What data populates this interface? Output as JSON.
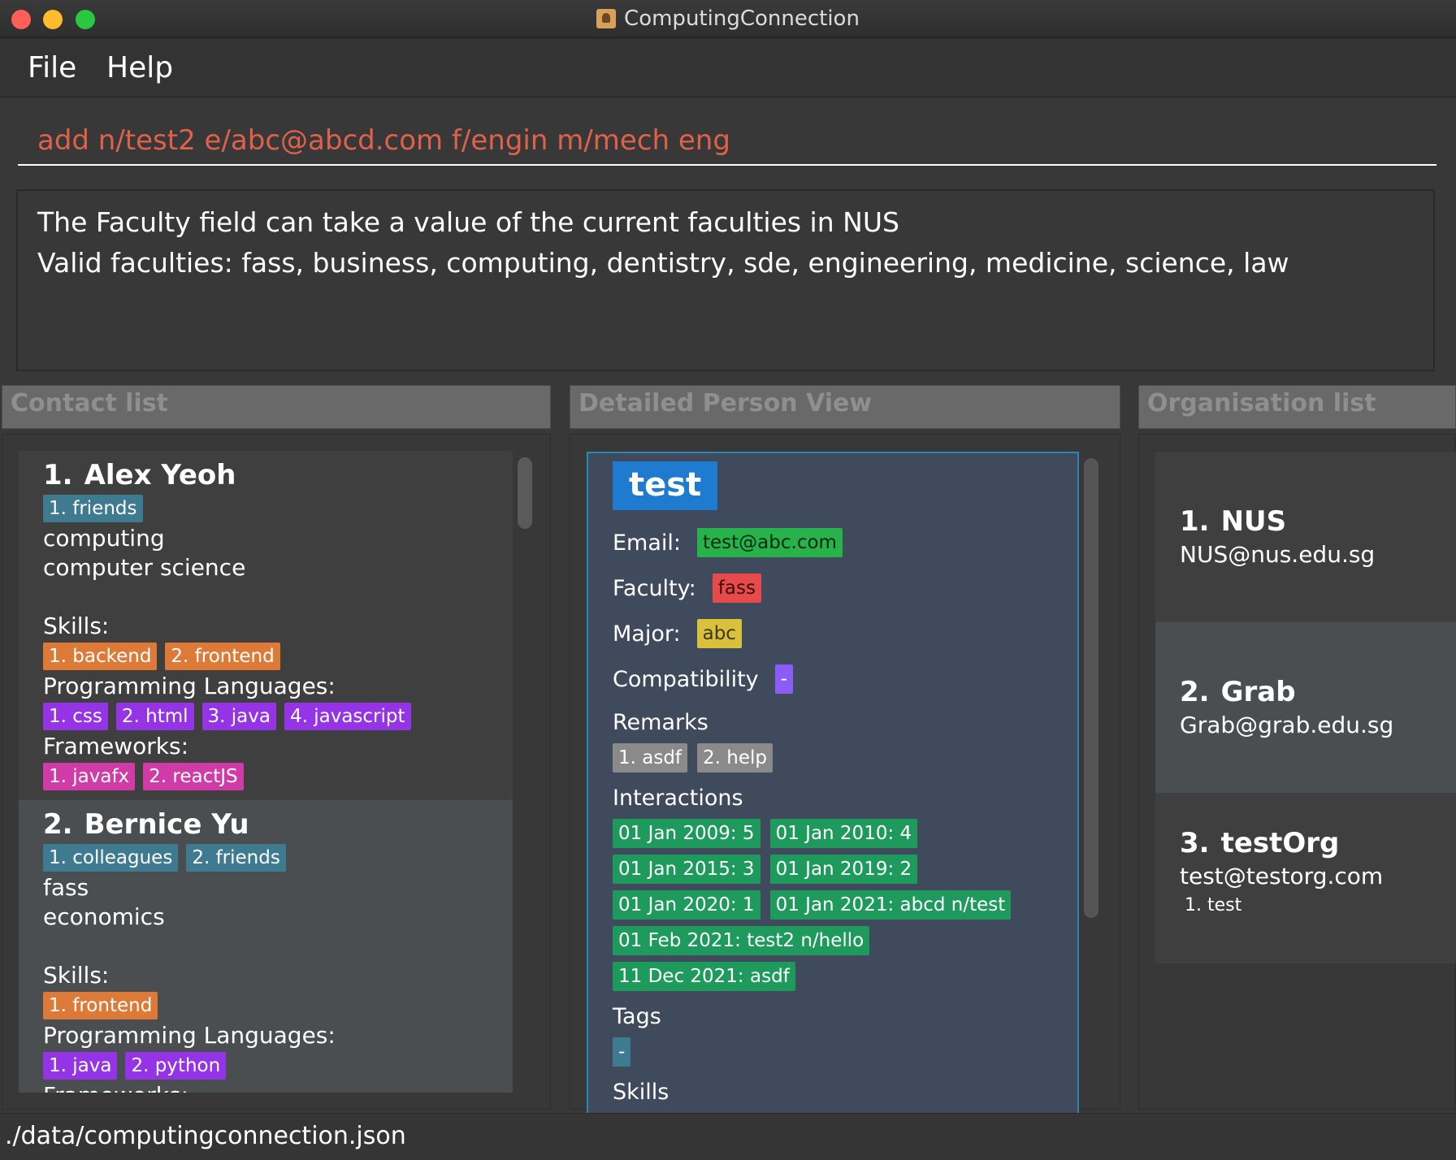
{
  "window": {
    "title": "ComputingConnection"
  },
  "menu": {
    "file": "File",
    "help": "Help"
  },
  "command": {
    "value": "add n/test2 e/abc@abcd.com f/engin m/mech eng"
  },
  "result": {
    "lines": [
      "The Faculty field can take a value of the current faculties in NUS",
      "Valid faculties: fass, business, computing, dentistry, sde, engineering, medicine, science, law"
    ]
  },
  "panels": {
    "contacts_title": "Contact list",
    "detail_title": "Detailed Person View",
    "orgs_title": "Organisation list"
  },
  "contacts": [
    {
      "index": "1.",
      "name": "Alex Yeoh",
      "tags": [
        "1. friends"
      ],
      "faculty": "computing",
      "major": "computer science",
      "skills_label": "Skills:",
      "skills": [
        "1. backend",
        "2. frontend"
      ],
      "languages_label": "Programming Languages:",
      "languages": [
        "1. css",
        "2. html",
        "3. java",
        "4. javascript"
      ],
      "frameworks_label": "Frameworks:",
      "frameworks": [
        "1. javafx",
        "2. reactJS"
      ]
    },
    {
      "index": "2.",
      "name": "Bernice Yu",
      "tags": [
        "1. colleagues",
        "2. friends"
      ],
      "faculty": "fass",
      "major": "economics",
      "skills_label": "Skills:",
      "skills": [
        "1. frontend"
      ],
      "languages_label": "Programming Languages:",
      "languages": [
        "1. java",
        "2. python"
      ],
      "frameworks_label": "Frameworks:",
      "frameworks": []
    }
  ],
  "detail": {
    "name": "test",
    "email_label": "Email:",
    "email": "test@abc.com",
    "faculty_label": "Faculty:",
    "faculty": "fass",
    "major_label": "Major:",
    "major": "abc",
    "compat_label": "Compatibility",
    "compat": "-",
    "remarks_label": "Remarks",
    "remarks": [
      "1. asdf",
      "2. help"
    ],
    "interactions_label": "Interactions",
    "interactions": [
      "01 Jan 2009: 5",
      "01 Jan 2010: 4",
      "01 Jan 2015: 3",
      "01 Jan 2019: 2",
      "01 Jan 2020: 1",
      "01 Jan 2021: abcd n/test",
      "01 Feb 2021: test2 n/hello",
      "11 Dec 2021: asdf"
    ],
    "tags_label": "Tags",
    "tags": [
      "-"
    ],
    "skills_label": "Skills"
  },
  "organisations": [
    {
      "index": "1.",
      "name": "NUS",
      "email": "NUS@nus.edu.sg",
      "members": []
    },
    {
      "index": "2.",
      "name": "Grab",
      "email": "Grab@grab.edu.sg",
      "members": []
    },
    {
      "index": "3.",
      "name": "testOrg",
      "email": "test@testorg.com",
      "members": [
        "1. test"
      ]
    }
  ],
  "status": {
    "file_path": "./data/computingconnection.json"
  },
  "colors": {
    "tag": "#3e7b91",
    "skill": "#dd7a37",
    "language": "#9434e6",
    "framework": "#d03ba7",
    "email": "#27b24a",
    "faculty": "#e64a4a",
    "major": "#d9c13b",
    "interaction": "#1e9a5c",
    "command_text": "#e0614a"
  }
}
